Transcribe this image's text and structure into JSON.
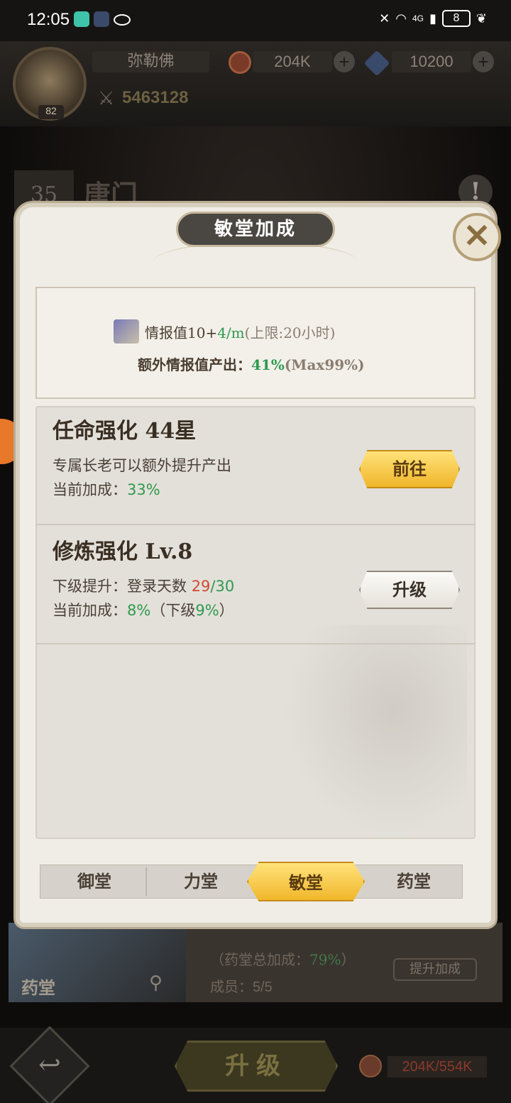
{
  "status_bar": {
    "time": "12:05",
    "battery": "8",
    "network": "4G"
  },
  "header": {
    "player_name": "弥勒佛",
    "avatar_level": "82",
    "gold": "204K",
    "diamonds": "10200",
    "power": "5463128"
  },
  "background": {
    "guild_level": "35",
    "guild_name": "唐门",
    "card_label": "药堂",
    "total_bonus_prefix": "（药堂总加成：",
    "total_bonus_value": "79%",
    "total_bonus_suffix": "）",
    "members": "成员：5/5",
    "boost_button": "提升加成"
  },
  "bottom": {
    "upgrade_label": "升级",
    "cost": "204K/554K"
  },
  "modal": {
    "title": "敏堂加成",
    "info": {
      "intel_prefix": "情报值10+",
      "intel_rate": "4/m",
      "intel_limit": "(上限:20小时)",
      "extra_label": "额外情报值产出：",
      "extra_value": "41%",
      "extra_max": "(Max99%)"
    },
    "rows": [
      {
        "title": "任命强化 44星",
        "desc": "专属长老可以额外提升产出",
        "bonus_label": "当前加成：",
        "bonus_value": "33%",
        "button": "前往"
      },
      {
        "title": "修炼强化 Lv.8",
        "next_label": "下级提升：登录天数 ",
        "next_current": "29",
        "next_total": "/30",
        "bonus_label": "当前加成：",
        "bonus_value": "8%",
        "bonus_next_prefix": "（下级",
        "bonus_next_value": "9%",
        "bonus_next_suffix": "）",
        "button": "升级"
      }
    ],
    "tabs": [
      "御堂",
      "力堂",
      "敏堂",
      "药堂"
    ],
    "active_tab": "敏堂"
  }
}
